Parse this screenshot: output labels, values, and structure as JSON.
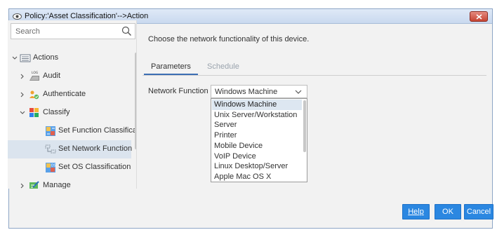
{
  "window": {
    "title": "Policy:'Asset Classification'-->Action",
    "close_label": "×"
  },
  "sidebar": {
    "search_placeholder": "Search",
    "items": [
      {
        "label": "Actions",
        "expanded": true,
        "icon": "list-icon"
      },
      {
        "label": "Audit",
        "expanded": false,
        "icon": "log-icon"
      },
      {
        "label": "Authenticate",
        "expanded": false,
        "icon": "users-check-icon"
      },
      {
        "label": "Classify",
        "expanded": true,
        "icon": "color-grid-icon"
      },
      {
        "label": "Set Function Classificat",
        "icon": "classification-icon"
      },
      {
        "label": "Set Network Function",
        "icon": "network-function-icon",
        "selected": true
      },
      {
        "label": "Set OS Classification",
        "icon": "os-classification-icon"
      },
      {
        "label": "Manage",
        "expanded": false,
        "icon": "manage-icon"
      }
    ]
  },
  "main": {
    "description": "Choose the network functionality of this device.",
    "tabs": [
      {
        "label": "Parameters",
        "active": true
      },
      {
        "label": "Schedule",
        "active": false
      }
    ],
    "network_function": {
      "label": "Network Function",
      "selected": "Windows Machine",
      "options": [
        "Windows Machine",
        "Unix Server/Workstation",
        "Server",
        "Printer",
        "Mobile Device",
        "VoIP Device",
        "Linux Desktop/Server",
        "Apple Mac OS X"
      ]
    }
  },
  "buttons": {
    "help": "Help",
    "ok": "OK",
    "cancel": "Cancel"
  },
  "colors": {
    "accent": "#2b87e1",
    "selection": "#dbe4ee",
    "titlebar": "#c9d9ef",
    "close": "#c74534"
  }
}
